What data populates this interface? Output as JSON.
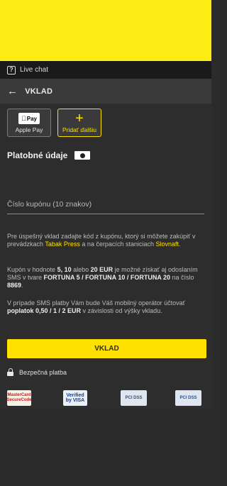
{
  "top_bar": {
    "live_chat_label": "Live chat",
    "chat_icon_glyph": "?"
  },
  "header": {
    "title": "VKLAD",
    "back_icon": "arrow-left-icon"
  },
  "payment_methods": {
    "apple_pay_logo": "Pay",
    "apple_pay_label": "Apple Pay",
    "add_label": "Pridať ďalšiu",
    "add_icon": "plus-icon"
  },
  "section": {
    "title": "Platobné údaje",
    "icon": "cash-icon"
  },
  "coupon": {
    "placeholder": "Číslo kupónu (10 znakov)",
    "value": ""
  },
  "info": {
    "p1_a": "Pre úspešný vklad zadajte kód z kupónu, ktorý si môžete zakúpiť v prevádzkach ",
    "p1_tabak": "Tabak Press",
    "p1_b": " a na čerpacích staniciach ",
    "p1_slovnaft": "Slovnaft",
    "p1_end": ".",
    "p2_a": "Kupón v hodnote ",
    "p2_values": "5, 10",
    "p2_b": " alebo ",
    "p2_eur": "20 EUR",
    "p2_c": " je možné získať aj odoslaním SMS v tvare ",
    "p2_sms": "FORTUNA 5 / FORTUNA 10 / FORTUNA 20",
    "p2_d": " na číslo ",
    "p2_number": "8869",
    "p2_end": ".",
    "p3_a": "V prípade SMS platby Vám bude Váš mobilný operátor účtovať ",
    "p3_fee": "poplatok 0,50 / 1 / 2 EUR",
    "p3_b": " v závislosti od výšky vkladu."
  },
  "submit_label": "VKLAD",
  "secure": {
    "label": "Bezpečná platba",
    "icon": "lock-icon"
  },
  "badges": {
    "mastercard": "MasterCard SecureCode",
    "visa": "Verified by VISA",
    "pci1": "PCI DSS",
    "pci2": "PCI DSS"
  },
  "colors": {
    "accent": "#ffe100",
    "background": "#2b2b2b",
    "header": "#3a3a3a"
  }
}
